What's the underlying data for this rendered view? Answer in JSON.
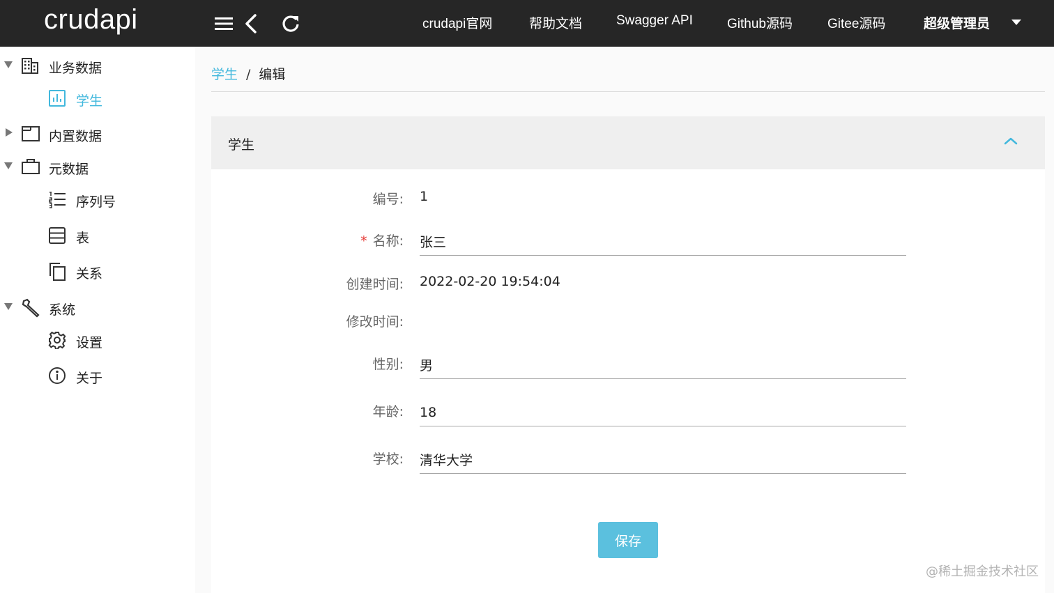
{
  "header": {
    "logo": "crudapi",
    "menu_icon": "hamburger-menu-icon",
    "back_icon": "chevron-left-icon",
    "refresh_icon": "refresh-icon",
    "nav": [
      {
        "label": "crudapi官网"
      },
      {
        "label": "帮助文档"
      },
      {
        "label": "Swagger API"
      },
      {
        "label": "Github源码"
      },
      {
        "label": "Gitee源码"
      }
    ],
    "user": "超级管理员",
    "bg_color": "#262626"
  },
  "sidebar": {
    "items": [
      {
        "label": "业务数据",
        "icon": "building-icon",
        "expanded": true
      },
      {
        "label": "学生",
        "icon": "bar-chart-icon",
        "active": true
      },
      {
        "label": "内置数据",
        "icon": "window-icon",
        "expanded": false
      },
      {
        "label": "元数据",
        "icon": "briefcase-icon",
        "expanded": true
      },
      {
        "label": "序列号",
        "icon": "numbered-list-icon"
      },
      {
        "label": "表",
        "icon": "table-icon"
      },
      {
        "label": "关系",
        "icon": "copy-icon"
      },
      {
        "label": "系统",
        "icon": "wrench-icon",
        "expanded": true
      },
      {
        "label": "设置",
        "icon": "gear-icon"
      },
      {
        "label": "关于",
        "icon": "info-icon"
      }
    ],
    "active_color": "#42b8dd"
  },
  "breadcrumb": {
    "parent": "学生",
    "separator": "/",
    "current": "编辑"
  },
  "panel": {
    "title": "学生",
    "collapse_icon": "chevron-up-icon"
  },
  "form": {
    "id_label": "编号:",
    "id_value": "1",
    "name_label": "名称:",
    "name_required": "*",
    "name_value": "张三",
    "created_label": "创建时间:",
    "created_value": "2022-02-20 19:54:04",
    "updated_label": "修改时间:",
    "updated_value": "",
    "gender_label": "性别:",
    "gender_value": "男",
    "age_label": "年龄:",
    "age_value": "18",
    "school_label": "学校:",
    "school_value": "清华大学"
  },
  "save_label": "保存",
  "save_color": "#5bc0de",
  "watermark": "@稀土掘金技术社区"
}
